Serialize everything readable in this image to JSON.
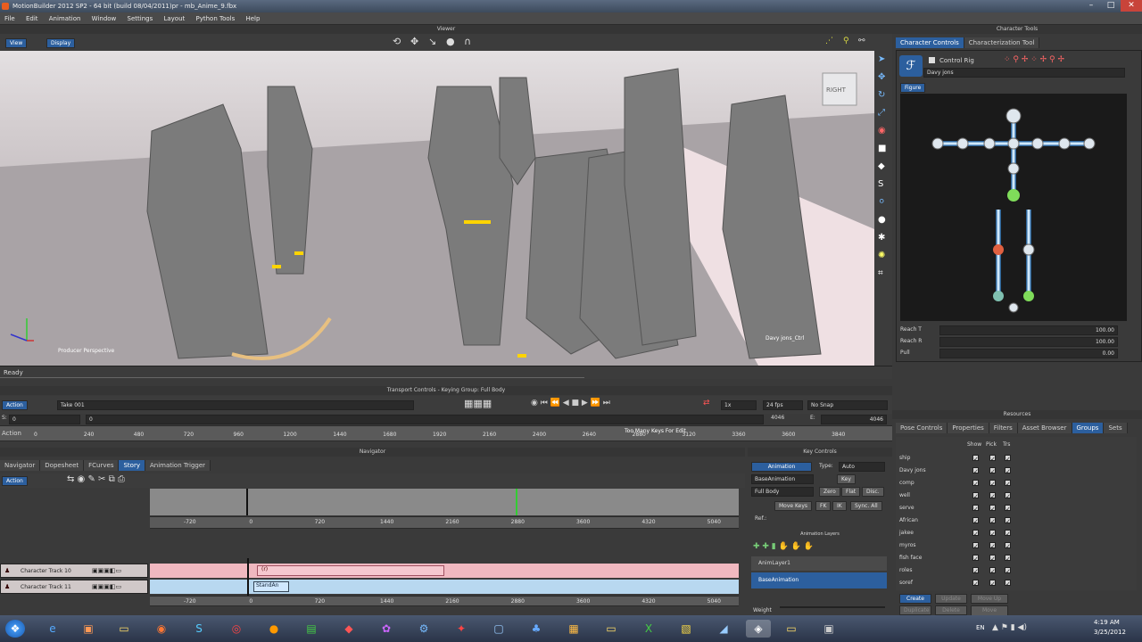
{
  "window": {
    "title": "MotionBuilder 2012 SP2 - 64 bit (build 08/04/2011)pr - mb_Anime_9.fbx"
  },
  "menu": [
    "File",
    "Edit",
    "Animation",
    "Window",
    "Settings",
    "Layout",
    "Python Tools",
    "Help"
  ],
  "viewer": {
    "panel_title": "Viewer",
    "view_btn": "View",
    "display_btn": "Display",
    "cube_label": "RIGHT",
    "camera_label": "Producer Perspective",
    "status": "Ready",
    "char_label": "Davy jons_Ctrl"
  },
  "char_tools": {
    "panel_title": "Character Tools",
    "tabs": [
      "Character Controls",
      "Characterization Tool"
    ],
    "control_rig": "Control Rig",
    "character": "Davy jons",
    "figure_tab": "Figure",
    "params": [
      {
        "label": "Reach T",
        "value": "100.00"
      },
      {
        "label": "Reach R",
        "value": "100.00"
      },
      {
        "label": "Pull",
        "value": "0.00"
      }
    ]
  },
  "transport": {
    "panel_title": "Transport Controls  -  Keying Group: Full Body",
    "mode": "Action",
    "take": "Take 001",
    "start_label": "S:",
    "start": "0",
    "cursor": "0",
    "speed": "1x",
    "fps": "24 fps",
    "snap": "No Snap",
    "end_frame": "4046",
    "end_label": "E:",
    "end": "4046",
    "ruler_label": "Action",
    "ticks": [
      "0",
      "240",
      "480",
      "720",
      "960",
      "1200",
      "1440",
      "1680",
      "1920",
      "2160",
      "2400",
      "2640",
      "2880",
      "3120",
      "3360",
      "3600",
      "3840"
    ],
    "warning": "Too Many Keys For Edit"
  },
  "navigator": {
    "panel_title": "Navigator",
    "tabs": [
      "Navigator",
      "Dopesheet",
      "FCurves",
      "Story",
      "Animation Trigger"
    ],
    "active_tab": "Story",
    "mode": "Action",
    "ticks": [
      "-720",
      "0",
      "720",
      "1440",
      "2160",
      "2880",
      "3600",
      "4320",
      "5040"
    ],
    "tracks": [
      {
        "name": "Character Track 10",
        "clip": "(r)"
      },
      {
        "name": "Character Track 11",
        "clip": "StandAn"
      }
    ]
  },
  "key_controls": {
    "panel_title": "Key Controls",
    "animation_btn": "Animation",
    "type_label": "Type:",
    "type_value": "Auto",
    "base_layer": "BaseAnimation",
    "key_btn": "Key",
    "body": "Full Body",
    "zero": "Zero",
    "flat": "Flat",
    "disc": "Disc.",
    "move_keys": "Move Keys",
    "fk": "FK",
    "ik": "IK",
    "sync": "Sync. All",
    "ref": "Ref.:",
    "layers_title": "Animation Layers",
    "layers": [
      "AnimLayer1",
      "BaseAnimation"
    ],
    "weight": "Weight"
  },
  "resources": {
    "panel_title": "Resources",
    "tabs": [
      "Pose Controls",
      "Properties",
      "Filters",
      "Asset Browser",
      "Groups",
      "Sets"
    ],
    "active_tab": "Groups",
    "columns": [
      "Show",
      "Pick",
      "Trs"
    ],
    "groups": [
      "ship",
      "Davy jons",
      "comp",
      "well",
      "serve",
      "African",
      "jakee",
      "myros",
      "fish face",
      "roles",
      "soref"
    ],
    "buttons": [
      "Create",
      "Update",
      "Move Up",
      "Duplicate",
      "Delete",
      "Move Down"
    ]
  },
  "taskbar": {
    "lang": "EN",
    "time": "4:19 AM",
    "date": "3/25/2012"
  },
  "colors": {
    "accent": "#2c5f9e",
    "clip_pink": "#f0b8c0",
    "clip_blue": "#b8d8f0",
    "rig_glow": "#3aa0ff"
  }
}
